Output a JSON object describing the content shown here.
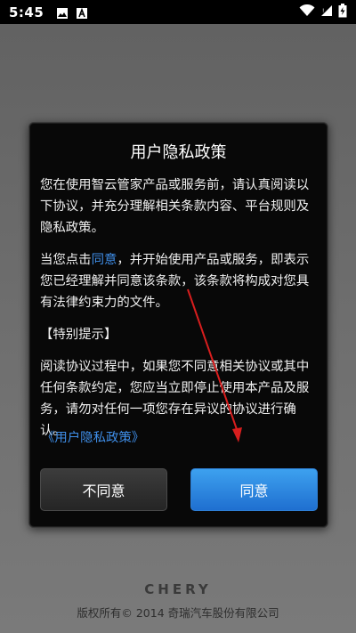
{
  "status_bar": {
    "time": "5:45",
    "icons_left": [
      "image-icon",
      "a-notification-icon"
    ],
    "icons_right": [
      "wifi-icon",
      "signal-icon",
      "battery-charging-icon"
    ]
  },
  "dialog": {
    "title": "用户隐私政策",
    "paragraph1": "您在使用智云管家产品或服务前，请认真阅读以下协议，并充分理解相关条款内容、平台规则及隐私政策。",
    "paragraph2_prefix": "当您点击",
    "paragraph2_link": "同意",
    "paragraph2_suffix": "，并开始使用产品或服务，即表示您已经理解并同意该条款，该条款将构成对您具有法律约束力的文件。",
    "notice_heading": "【特别提示】",
    "paragraph3": "阅读协议过程中，如果您不同意相关协议或其中任何条款约定，您应当立即停止使用本产品及服务，请勿对任何一项您存在异议的协议进行确认。",
    "policy_link": "《用户隐私政策》",
    "disagree_label": "不同意",
    "agree_label": "同意"
  },
  "footer": {
    "brand": "CHERY",
    "copyright": "版权所有© 2014 奇瑞汽车股份有限公司"
  },
  "colors": {
    "accent_link": "#3f8ee8",
    "agree_button": "#2a82dc",
    "annotation_arrow": "#d81e1e"
  }
}
